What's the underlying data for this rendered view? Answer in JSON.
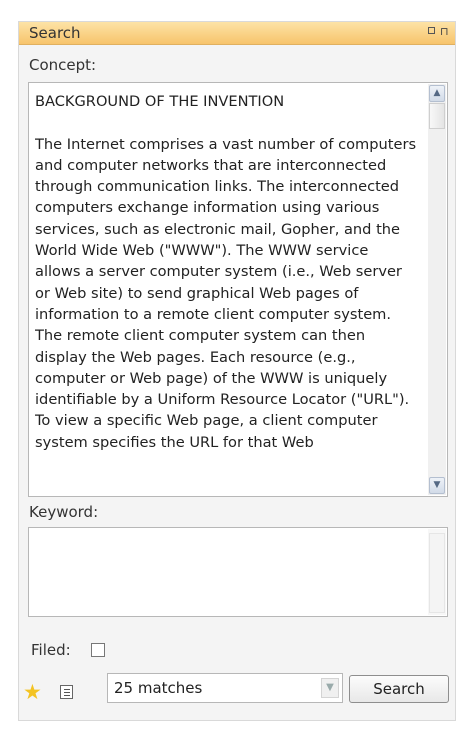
{
  "panel": {
    "title": "Search",
    "restore_icon": "restore-icon",
    "pin_icon": "pin-icon"
  },
  "concept": {
    "label": "Concept:",
    "text": "BACKGROUND OF THE INVENTION\n\nThe Internet comprises a vast number of computers and computer networks that are interconnected through communication links. The interconnected computers exchange information using various services, such as electronic mail, Gopher, and the World Wide Web (\"WWW\"). The WWW service allows a server computer system (i.e., Web server or Web site) to send graphical Web pages of information to a remote client computer system. The remote client computer system can then display the Web pages. Each resource (e.g., computer or Web page) of the WWW is uniquely identifiable by a Uniform Resource Locator (\"URL\"). To view a specific Web page, a client computer system specifies the URL for that Web"
  },
  "keyword": {
    "label": "Keyword:",
    "value": ""
  },
  "filed": {
    "label": "Filed:",
    "checked": false
  },
  "footer": {
    "matches_selected": "25 matches",
    "search_label": "Search",
    "favorite_icon": "star-icon",
    "list_icon": "list-icon"
  },
  "colors": {
    "titlebar": "#f7c46c",
    "panel_bg": "#f4f4f4",
    "star": "#f3c323"
  }
}
